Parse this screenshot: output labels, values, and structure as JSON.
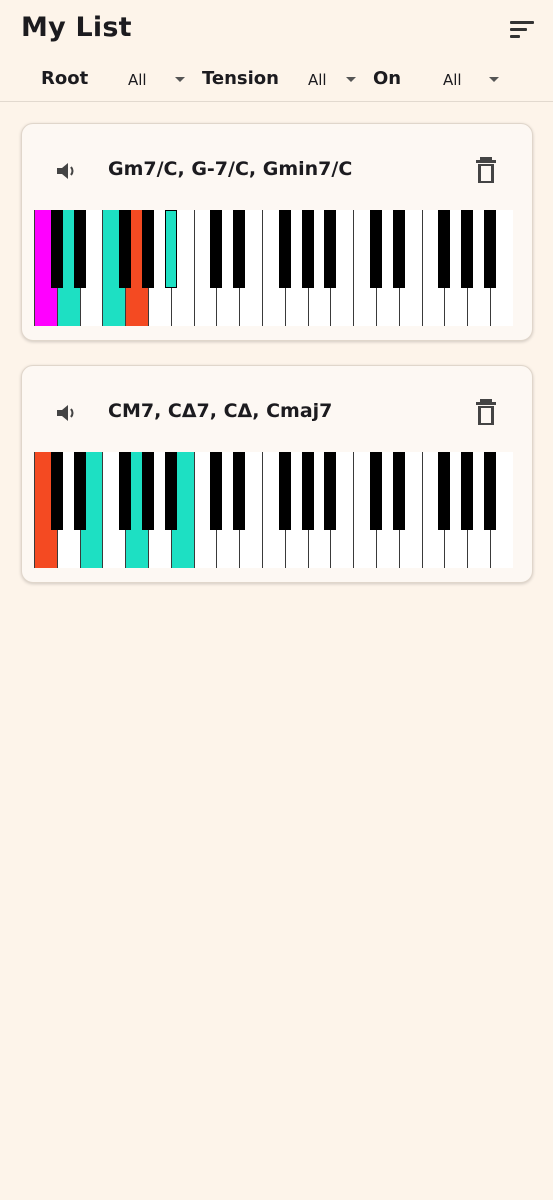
{
  "header": {
    "title": "My List",
    "sort_icon": "sort-icon"
  },
  "filters": [
    {
      "label": "Root",
      "value": "All"
    },
    {
      "label": "Tension",
      "value": "All"
    },
    {
      "label": "On",
      "value": "All"
    }
  ],
  "colors": {
    "root": "#f44a22",
    "chord_tone": "#1de0c3",
    "bass": "#ff00ff",
    "background": "#fdf4ea"
  },
  "chords": [
    {
      "name": "Gm7/C, G-7/C, Gmin7/C",
      "speaker_icon": "speaker-icon",
      "delete_icon": "trash-icon",
      "keys": [
        {
          "note": "C",
          "role": "bass"
        },
        {
          "note": "G",
          "role": "root"
        },
        {
          "note": "Bb",
          "role": "chord_tone"
        },
        {
          "note": "D",
          "role": "chord_tone"
        },
        {
          "note": "F",
          "role": "chord_tone"
        }
      ]
    },
    {
      "name": "CM7, CΔ7, CΔ, Cmaj7",
      "speaker_icon": "speaker-icon",
      "delete_icon": "trash-icon",
      "keys": [
        {
          "note": "C",
          "role": "root"
        },
        {
          "note": "E",
          "role": "chord_tone"
        },
        {
          "note": "G",
          "role": "chord_tone"
        },
        {
          "note": "B",
          "role": "chord_tone"
        }
      ]
    }
  ]
}
